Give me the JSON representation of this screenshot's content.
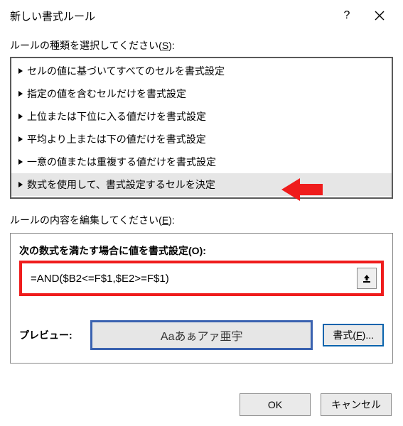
{
  "titlebar": {
    "title": "新しい書式ルール"
  },
  "ruleType": {
    "label": "ルールの種類を選択してください(",
    "accel": "S",
    "label_suffix": "):",
    "items": [
      "セルの値に基づいてすべてのセルを書式設定",
      "指定の値を含むセルだけを書式設定",
      "上位または下位に入る値だけを書式設定",
      "平均より上または下の値だけを書式設定",
      "一意の値または重複する値だけを書式設定",
      "数式を使用して、書式設定するセルを決定"
    ]
  },
  "edit": {
    "section_label": "ルールの内容を編集してください(",
    "section_accel": "E",
    "section_suffix": "):",
    "formula_label": "次の数式を満たす場合に値を書式設定(",
    "formula_accel": "O",
    "formula_suffix": "):",
    "formula_value": "=AND($B2<=F$1,$E2>=F$1)",
    "preview_label": "プレビュー:",
    "preview_text": "Aaあぁアァ亜宇",
    "format_btn_prefix": "書式(",
    "format_btn_accel": "F",
    "format_btn_suffix": ")..."
  },
  "buttons": {
    "ok": "OK",
    "cancel": "キャンセル"
  }
}
